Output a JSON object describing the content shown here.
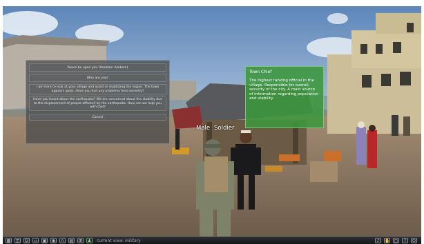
{
  "dialog": {
    "options": [
      "Peace be upon you (Assalam Aleikom)",
      "Who are you?",
      "I am here to look at your village and assist in stabilizing the region. The town appears quiet. Have you had any problems here recently?",
      "Have you heard about the earthquake? We are concerned about the stability due to the displacement of people affected by the earthquake. How can we help you with that?"
    ],
    "cancel": "Cancel"
  },
  "info_panel": {
    "title": "Town Chief",
    "description": "The highest ranking official in the village. Responsible for overall security of the city. A main source of information regarding population and stability."
  },
  "labels": {
    "left": "Male",
    "right": "Soldier"
  },
  "hud": {
    "status": "current view: military"
  }
}
